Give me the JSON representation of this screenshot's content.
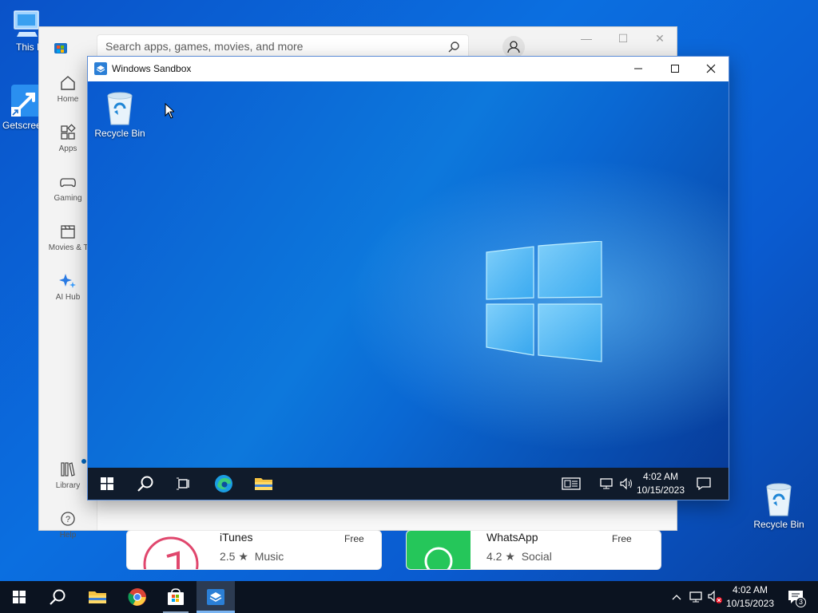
{
  "desktop": {
    "icons": [
      {
        "label": "This PC",
        "icon": "this-pc-icon"
      },
      {
        "label": "Getscreen",
        "icon": "getscreen-icon"
      },
      {
        "label": "Recycle Bin",
        "icon": "recycle-bin-icon"
      }
    ]
  },
  "store": {
    "search_placeholder": "Search apps, games, movies, and more",
    "nav": [
      {
        "label": "Home",
        "icon": "home-icon"
      },
      {
        "label": "Apps",
        "icon": "apps-icon"
      },
      {
        "label": "Gaming",
        "icon": "gaming-icon"
      },
      {
        "label": "Movies & TV",
        "icon": "movies-icon"
      },
      {
        "label": "AI Hub",
        "icon": "ai-hub-icon"
      },
      {
        "label": "Library",
        "icon": "library-icon"
      },
      {
        "label": "Help",
        "icon": "help-icon"
      }
    ],
    "apps": [
      {
        "name": "iTunes",
        "price": "Free",
        "rating": "2.5 ★",
        "category": "Music"
      },
      {
        "name": "WhatsApp",
        "price": "Free",
        "rating": "4.2 ★",
        "category": "Social"
      }
    ]
  },
  "sandbox": {
    "title": "Windows Sandbox",
    "desktop_icon_label": "Recycle Bin",
    "clock_time": "4:02 AM",
    "clock_date": "10/15/2023"
  },
  "taskbar": {
    "clock_time": "4:02 AM",
    "clock_date": "10/15/2023",
    "notification_count": "3"
  },
  "colors": {
    "accent": "#0078d4",
    "desktop_blue": "#0b6fe0",
    "taskbar": "#0b1320"
  }
}
